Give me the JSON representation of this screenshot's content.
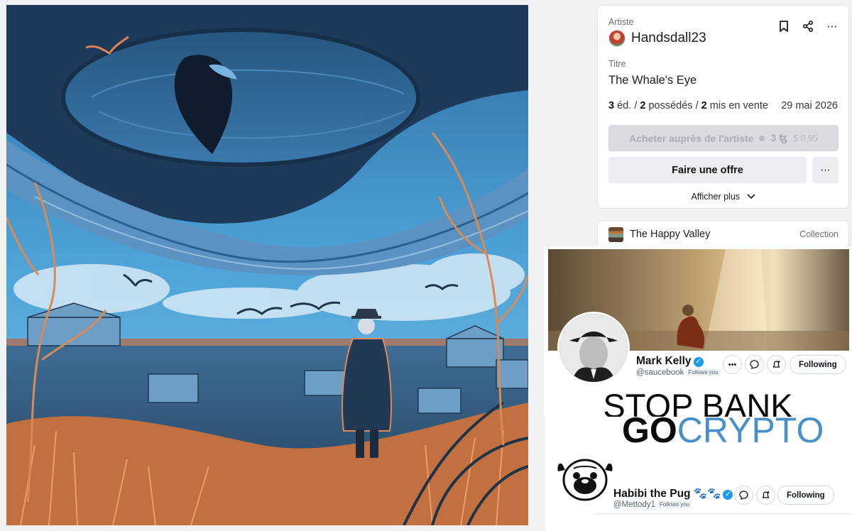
{
  "listing": {
    "artist_label": "Artiste",
    "artist_name": "Handsdall23",
    "title_label": "Titre",
    "title": "The Whale's Eye",
    "editions_num": "3",
    "editions_txt": "éd.",
    "owned_num": "2",
    "owned_txt": "possédés",
    "sale_num": "2",
    "sale_txt": "mis en vente",
    "separator": "/",
    "date": "29 mai 2026",
    "buy_label": "Acheter auprès de l'artiste",
    "price_tez": "3 ꜩ",
    "price_usd": "$ 0,95",
    "offer_label": "Faire une offre",
    "show_more": "Afficher plus",
    "icons": [
      "bookmark-icon",
      "share-icon",
      "more-icon"
    ]
  },
  "collection": {
    "name": "The Happy Valley",
    "type_label": "Collection"
  },
  "tweet1": {
    "name": "Mark Kelly",
    "handle": "@saucebook",
    "follows_you": "Follows you",
    "follow_label": "Following",
    "slogan_line1": "STOP BANK",
    "slogan_go": "GO",
    "slogan_crypto": "CRYPTO"
  },
  "tweet2": {
    "name": "Habibi the Pug 🐾🐾",
    "handle": "@Mettody1",
    "follows_you": "Follows you",
    "follow_label": "Following"
  },
  "colors": {
    "verified": "#1d9bf0",
    "crypto_blue": "#4a90c8",
    "button_disabled": "#d9dbe0",
    "sky": "#4d9fd6",
    "orange": "#e08452"
  }
}
